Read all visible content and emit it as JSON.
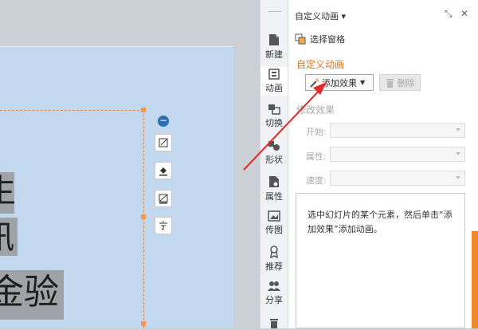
{
  "sidebar": {
    "items": [
      {
        "label": "新建",
        "icon": "new-file-icon"
      },
      {
        "label": "动画",
        "icon": "animation-icon"
      },
      {
        "label": "切换",
        "icon": "transition-icon"
      },
      {
        "label": "形状",
        "icon": "shape-icon"
      },
      {
        "label": "属性",
        "icon": "properties-icon"
      },
      {
        "label": "传图",
        "icon": "upload-image-icon"
      },
      {
        "label": "推荐",
        "icon": "recommend-icon"
      },
      {
        "label": "分享",
        "icon": "share-icon"
      }
    ]
  },
  "panel": {
    "title": "自定义动画 ▾",
    "selection_pane": "选择窗格",
    "section_title": "自定义动画",
    "add_effect": "添加效果",
    "delete": "删除",
    "modify_title": "修改效果",
    "fields": [
      {
        "label": "开始:"
      },
      {
        "label": "属性:"
      },
      {
        "label": "速度:"
      }
    ],
    "info": "选中幻灯片的某个元素，然后单击“添加效果”添加动画。"
  },
  "slide": {
    "chars": [
      "生",
      "汛",
      "金验"
    ]
  },
  "colors": {
    "accent_orange": "#f08a2b",
    "section_title": "#c97a2b",
    "annotation_arrow": "#e02b2b",
    "slide_bg": "#c2d8ef"
  }
}
